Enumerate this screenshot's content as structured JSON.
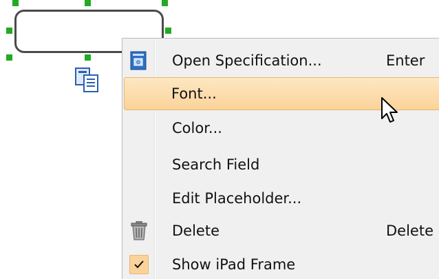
{
  "canvas": {
    "shape_name": "search-field-shape"
  },
  "context_menu": {
    "items": [
      {
        "label": "Open Specification...",
        "shortcut": "Enter",
        "icon": "specification-icon",
        "highlighted": false
      },
      {
        "label": "Font...",
        "shortcut": "",
        "icon": "",
        "highlighted": true
      },
      {
        "label": "Color...",
        "shortcut": "",
        "icon": "",
        "highlighted": false
      },
      {
        "label": "Search Field",
        "shortcut": "",
        "icon": "",
        "highlighted": false
      },
      {
        "label": "Edit Placeholder...",
        "shortcut": "",
        "icon": "",
        "highlighted": false
      },
      {
        "label": "Delete",
        "shortcut": "Delete",
        "icon": "trash-icon",
        "highlighted": false
      },
      {
        "label": "Show iPad Frame",
        "shortcut": "",
        "icon": "checkmark-icon",
        "checked": true,
        "highlighted": false
      }
    ]
  },
  "colors": {
    "selection_handle": "#22aa22",
    "highlight": "#fbd39a",
    "menu_background": "#f0f0f0"
  }
}
